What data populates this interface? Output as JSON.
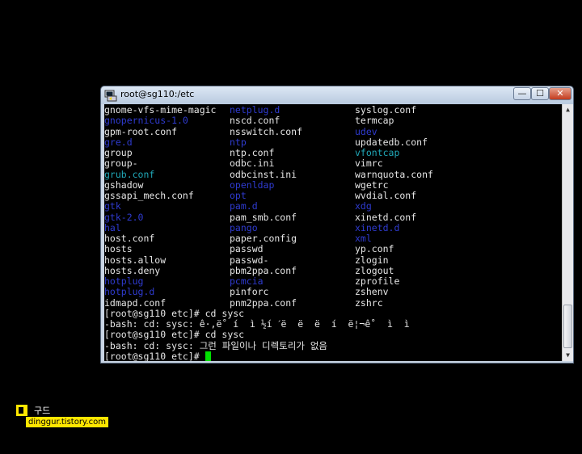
{
  "window": {
    "title": "root@sg110:/etc",
    "min": "—",
    "max": "☐",
    "close": "✕"
  },
  "listing": [
    [
      {
        "t": "gnome-vfs-mime-magic",
        "c": "w"
      },
      {
        "t": "netplug.d",
        "c": "b"
      },
      {
        "t": "syslog.conf",
        "c": "w"
      }
    ],
    [
      {
        "t": "gnopernicus-1.0",
        "c": "b"
      },
      {
        "t": "nscd.conf",
        "c": "w"
      },
      {
        "t": "termcap",
        "c": "w"
      }
    ],
    [
      {
        "t": "gpm-root.conf",
        "c": "w"
      },
      {
        "t": "nsswitch.conf",
        "c": "w"
      },
      {
        "t": "udev",
        "c": "b"
      }
    ],
    [
      {
        "t": "gre.d",
        "c": "b"
      },
      {
        "t": "ntp",
        "c": "b"
      },
      {
        "t": "updatedb.conf",
        "c": "w"
      }
    ],
    [
      {
        "t": "group",
        "c": "w"
      },
      {
        "t": "ntp.conf",
        "c": "w"
      },
      {
        "t": "vfontcap",
        "c": "cy"
      }
    ],
    [
      {
        "t": "group-",
        "c": "w"
      },
      {
        "t": "odbc.ini",
        "c": "w"
      },
      {
        "t": "vimrc",
        "c": "w"
      }
    ],
    [
      {
        "t": "grub.conf",
        "c": "cy"
      },
      {
        "t": "odbcinst.ini",
        "c": "w"
      },
      {
        "t": "warnquota.conf",
        "c": "w"
      }
    ],
    [
      {
        "t": "gshadow",
        "c": "w"
      },
      {
        "t": "openldap",
        "c": "b"
      },
      {
        "t": "wgetrc",
        "c": "w"
      }
    ],
    [
      {
        "t": "gssapi_mech.conf",
        "c": "w"
      },
      {
        "t": "opt",
        "c": "b"
      },
      {
        "t": "wvdial.conf",
        "c": "w"
      }
    ],
    [
      {
        "t": "gtk",
        "c": "b"
      },
      {
        "t": "pam.d",
        "c": "b"
      },
      {
        "t": "xdg",
        "c": "b"
      }
    ],
    [
      {
        "t": "gtk-2.0",
        "c": "b"
      },
      {
        "t": "pam_smb.conf",
        "c": "w"
      },
      {
        "t": "xinetd.conf",
        "c": "w"
      }
    ],
    [
      {
        "t": "hal",
        "c": "b"
      },
      {
        "t": "pango",
        "c": "b"
      },
      {
        "t": "xinetd.d",
        "c": "b"
      }
    ],
    [
      {
        "t": "host.conf",
        "c": "w"
      },
      {
        "t": "paper.config",
        "c": "w"
      },
      {
        "t": "xml",
        "c": "b"
      }
    ],
    [
      {
        "t": "hosts",
        "c": "w"
      },
      {
        "t": "passwd",
        "c": "w"
      },
      {
        "t": "yp.conf",
        "c": "w"
      }
    ],
    [
      {
        "t": "hosts.allow",
        "c": "w"
      },
      {
        "t": "passwd-",
        "c": "w"
      },
      {
        "t": "zlogin",
        "c": "w"
      }
    ],
    [
      {
        "t": "hosts.deny",
        "c": "w"
      },
      {
        "t": "pbm2ppa.conf",
        "c": "w"
      },
      {
        "t": "zlogout",
        "c": "w"
      }
    ],
    [
      {
        "t": "hotplug",
        "c": "b"
      },
      {
        "t": "pcmcia",
        "c": "b"
      },
      {
        "t": "zprofile",
        "c": "w"
      }
    ],
    [
      {
        "t": "hotplug.d",
        "c": "b"
      },
      {
        "t": "pinforc",
        "c": "w"
      },
      {
        "t": "zshenv",
        "c": "w"
      }
    ],
    [
      {
        "t": "idmapd.conf",
        "c": "w"
      },
      {
        "t": "pnm2ppa.conf",
        "c": "w"
      },
      {
        "t": "zshrc",
        "c": "w"
      }
    ]
  ],
  "session": [
    "[root@sg110 etc]# cd sysc",
    "-bash: cd: sysc: ê·,ë˚ í  ì ½í ˊë  ë  ë  í  ë¦¬ê˚  ì  ì",
    "[root@sg110 etc]# cd sysc",
    "-bash: cd: sysc: 그런 파일이나 디렉토리가 없음",
    "[root@sg110 etc]# "
  ],
  "watermark": {
    "name": "구드",
    "url": "dinggur.tistory.com"
  },
  "colors": {
    "term_bg": "#000000",
    "dir": "#2f3bd0",
    "link": "#20a8b8",
    "text": "#e6e6e6",
    "cursor": "#00e000"
  }
}
